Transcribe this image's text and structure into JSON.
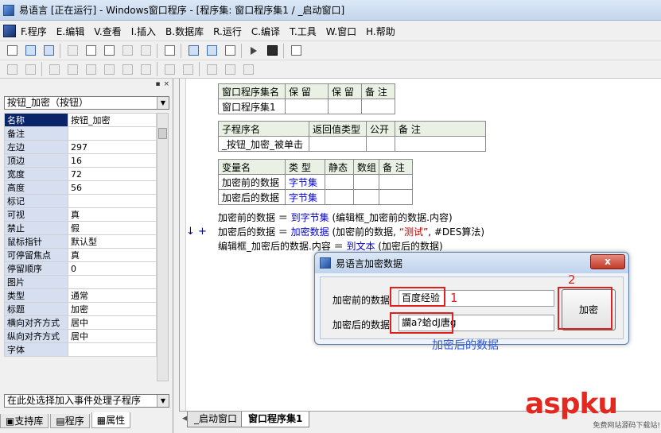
{
  "window": {
    "title": "易语言 [正在运行] - Windows窗口程序 - [程序集: 窗口程序集1 / _启动窗口]"
  },
  "menu": [
    "F.程序",
    "E.编辑",
    "V.查看",
    "I.插入",
    "B.数据库",
    "R.运行",
    "C.编译",
    "T.工具",
    "W.窗口",
    "H.帮助"
  ],
  "left_panel": {
    "object_selector": "按钮_加密（按钮）",
    "properties": [
      {
        "name": "名称",
        "value": "按钮_加密",
        "selected": true
      },
      {
        "name": "备注",
        "value": ""
      },
      {
        "name": "左边",
        "value": "297"
      },
      {
        "name": "顶边",
        "value": "16"
      },
      {
        "name": "宽度",
        "value": "72"
      },
      {
        "name": "高度",
        "value": "56"
      },
      {
        "name": "标记",
        "value": ""
      },
      {
        "name": "可视",
        "value": "真"
      },
      {
        "name": "禁止",
        "value": "假"
      },
      {
        "name": "鼠标指针",
        "value": "默认型"
      },
      {
        "name": "可停留焦点",
        "value": "真"
      },
      {
        "name": "停留顺序",
        "value": "0"
      },
      {
        "name": "图片",
        "value": ""
      },
      {
        "name": "类型",
        "value": "通常"
      },
      {
        "name": "标题",
        "value": "加密"
      },
      {
        "name": "横向对齐方式",
        "value": "居中"
      },
      {
        "name": "纵向对齐方式",
        "value": "居中"
      },
      {
        "name": "字体",
        "value": ""
      }
    ],
    "event_selector": "在此处选择加入事件处理子程序",
    "tabs": [
      "支持库",
      "程序",
      "属性"
    ]
  },
  "editor": {
    "assembly_table": {
      "headers": [
        "窗口程序集名",
        "保 留",
        "保 留",
        "备 注"
      ],
      "row": [
        "窗口程序集1",
        "",
        "",
        ""
      ]
    },
    "sub_table": {
      "headers": [
        "子程序名",
        "返回值类型",
        "公开",
        "备 注"
      ],
      "row": [
        "_按钮_加密_被单击",
        "",
        "",
        ""
      ]
    },
    "var_table": {
      "headers": [
        "变量名",
        "类 型",
        "静态",
        "数组",
        "备 注"
      ],
      "rows": [
        [
          "加密前的数据",
          "字节集",
          "",
          "",
          ""
        ],
        [
          "加密后的数据",
          "字节集",
          "",
          "",
          ""
        ]
      ]
    },
    "code": {
      "line1_a": "加密前的数据 ＝ ",
      "line1_fn": "到字节集",
      "line1_b": " (编辑框_加密前的数据.内容)",
      "line2_a": "加密后的数据 ＝ ",
      "line2_fn": "加密数据",
      "line2_b": " (加密前的数据, ",
      "line2_str": "“测试”",
      "line2_c": ", #DES算法)",
      "line3_a": "编辑框_加密后的数据.内容 ＝ ",
      "line3_fn": "到文本",
      "line3_b": " (加密后的数据)"
    },
    "marker": "↓ +"
  },
  "dialog": {
    "title": "易语言加密数据",
    "close": "x",
    "label_before": "加密前的数据",
    "value_before": "百度经验",
    "label_after": "加密后的数据",
    "value_after": "讕a?蛤dJ唐g",
    "button": "加密"
  },
  "annotations": {
    "num1": "1",
    "num2": "2",
    "caption": "加密后的数据"
  },
  "file_tabs": [
    "_启动窗口",
    "窗口程序集1"
  ],
  "watermark": {
    "brand": "aspku",
    "sub": "免费网站源码下载站!"
  }
}
